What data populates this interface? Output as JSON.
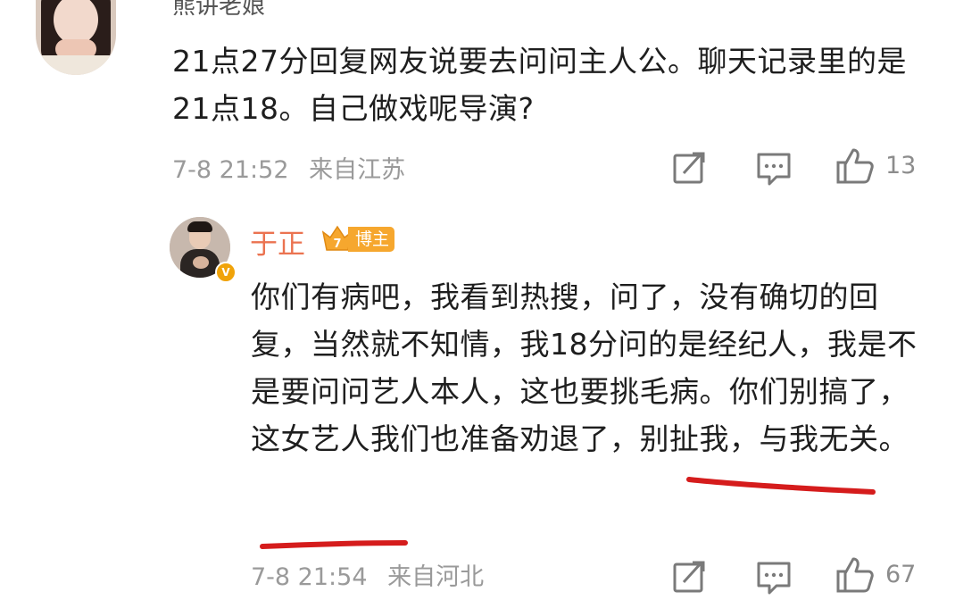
{
  "top_comment": {
    "username": "熊讲老娘",
    "text": "21点27分回复网友说要去问问主人公。聊天记录里的是21点18。自己做戏呢导演?",
    "time": "7-8 21:52",
    "location": "来自江苏",
    "like_count": "13",
    "actions": [
      "share-icon",
      "comment-icon",
      "like-icon"
    ]
  },
  "reply": {
    "username": "于正",
    "badge_label": "博主",
    "verified": "V",
    "text": "你们有病吧，我看到热搜，问了，没有确切的回复，当然就不知情，我18分问的是经纪人，我是不是要问问艺人本人，这也要挑毛病。你们别搞了，这女艺人我们也准备劝退了，别扯我，与我无关。",
    "time": "7-8 21:54",
    "location": "来自河北",
    "like_count": "67",
    "actions": [
      "share-icon",
      "comment-icon",
      "like-icon"
    ]
  },
  "colors": {
    "username_highlight": "#eb7350",
    "badge": "#f6a72e",
    "meta_gray": "#9a9a9a",
    "underline_red": "#d51c1c"
  }
}
